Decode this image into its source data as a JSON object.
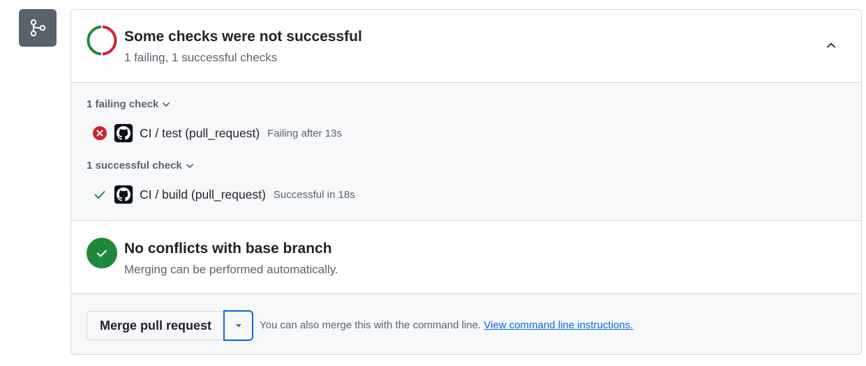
{
  "status": {
    "title": "Some checks were not successful",
    "subtitle": "1 failing, 1 successful checks"
  },
  "checks": {
    "failing_group": {
      "label": "1 failing check",
      "items": [
        {
          "name": "CI / test (pull_request)",
          "meta": "Failing after 13s",
          "status": "failure"
        }
      ]
    },
    "successful_group": {
      "label": "1 successful check",
      "items": [
        {
          "name": "CI / build (pull_request)",
          "meta": "Successful in 18s",
          "status": "success"
        }
      ]
    }
  },
  "conflicts": {
    "title": "No conflicts with base branch",
    "subtitle": "Merging can be performed automatically."
  },
  "merge": {
    "button_label": "Merge pull request",
    "hint_text": "You can also merge this with the command line.",
    "hint_link": "View command line instructions."
  },
  "colors": {
    "failure": "#cf222e",
    "success": "#1f883d",
    "link": "#0969da",
    "muted": "#59636e"
  },
  "icons": {
    "branch": "git-merge-icon",
    "status_ring": "checks-status-ring-icon",
    "collapse": "chevron-up-icon",
    "group_toggle": "chevron-down-icon",
    "failure": "x-circle-fill-icon",
    "success": "check-icon",
    "provider": "github-logo-icon",
    "conflicts_ok": "check-circle-fill-icon",
    "dropdown": "triangle-down-icon"
  }
}
